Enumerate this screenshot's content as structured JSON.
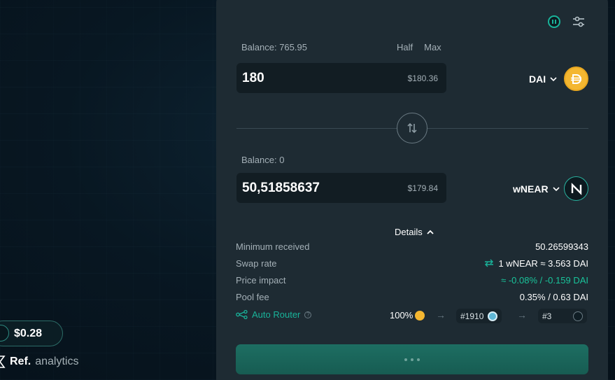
{
  "sidebar": {
    "price": "$0.28",
    "analytics_brand": "Ref.",
    "analytics_label": "analytics"
  },
  "swap": {
    "from": {
      "balance_label": "Balance: 765.95",
      "half_label": "Half",
      "max_label": "Max",
      "amount": "180",
      "usd_value": "$180.36",
      "token": "DAI",
      "token_icon": "dai-coin-icon"
    },
    "to": {
      "balance_label": "Balance: 0",
      "amount": "50,51858637",
      "usd_value": "$179.84",
      "token": "wNEAR",
      "token_icon": "wnear-coin-icon"
    },
    "details_label": "Details",
    "details": {
      "min_received": {
        "label": "Minimum received",
        "value": "50.26599343"
      },
      "swap_rate": {
        "label": "Swap rate",
        "value": "1 wNEAR ≈ 3.563 DAI"
      },
      "price_impact": {
        "label": "Price impact",
        "value": "≈ -0.08% / -0.159 DAI"
      },
      "pool_fee": {
        "label": "Pool fee",
        "value": "0.35% / 0.63 DAI"
      }
    },
    "router": {
      "label": "Auto Router",
      "percent": "100%",
      "arrow": "→",
      "pools": [
        "#1910",
        "#3"
      ]
    }
  },
  "colors": {
    "accent": "#19b39a",
    "panel_bg": "#1e2b33",
    "input_bg": "#121d23",
    "button": "#1d6e62",
    "dai": "#f4b731"
  }
}
